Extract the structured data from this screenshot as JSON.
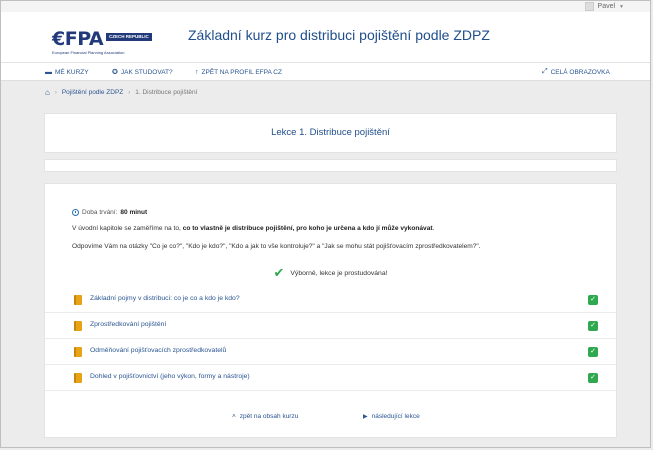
{
  "user": {
    "name": "Pavel"
  },
  "header": {
    "logo": {
      "word": "€FPA",
      "badge": "CZECH REPUBLIC",
      "subtitle": "European Financial Planning Association"
    },
    "course_title": "Základní kurz pro distribuci pojištění podle ZDPZ"
  },
  "navbar": {
    "my_courses": "MÉ KURZY",
    "how_to_study": "JAK STUDOVAT?",
    "back_to_profile": "ZPĚT NA PROFIL EFPA CZ",
    "fullscreen": "CELÁ OBRAZOVKA"
  },
  "breadcrumb": {
    "course": "Pojištění podle ZDPZ",
    "lesson": "1. Distribuce pojištění"
  },
  "lesson": {
    "title": "Lekce 1. Distribuce pojištění",
    "duration_label": "Doba trvání:",
    "duration_value": "80 minut",
    "intro1_a": "V úvodní kapitole se zaměříme na to, ",
    "intro1_b": "co to vlastně je distribuce pojištění, pro koho je určena a kdo jí může vykonávat",
    "intro1_c": ".",
    "intro2": "Odpovíme Vám na otázky \"Co je co?\", \"Kdo je kdo?\", \"Kdo  a jak to vše kontroluje?\" a \"Jak se mohu stát pojišťovacím zprostředkovatelem?\".",
    "status": "Výborně, lekce je prostudována!",
    "topics": [
      {
        "label": "Základní pojmy v distribuci: co je co a kdo je kdo?",
        "done": true
      },
      {
        "label": "Zprostředkování pojištění",
        "done": true
      },
      {
        "label": "Odměňování pojišťovacích zprostředkovatelů",
        "done": true
      },
      {
        "label": "Dohled v pojišťovnictví (jeho výkon, formy a nástroje)",
        "done": true
      }
    ],
    "back_to_contents": "zpět na obsah kurzu",
    "next_lesson": "následující lekce"
  },
  "colors": {
    "accent": "#2a5591",
    "title": "#1f4e8c",
    "success": "#2fa84f",
    "book": "#e8a317"
  }
}
